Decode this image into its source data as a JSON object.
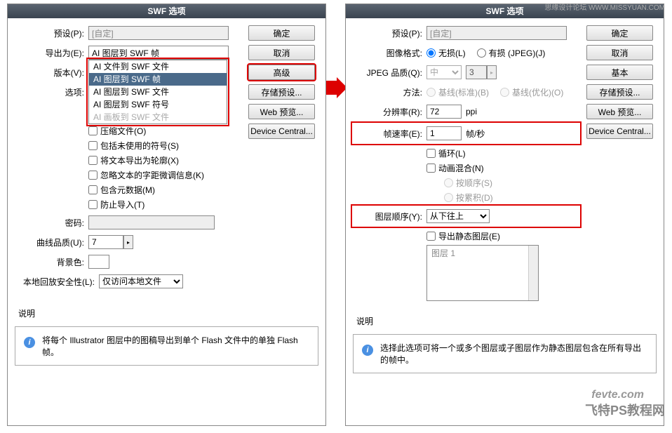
{
  "shared": {
    "title": "SWF 选项",
    "preset_label": "预设(P):",
    "preset_value": "[自定]",
    "desc_header": "说明"
  },
  "buttons": {
    "ok": "确定",
    "cancel": "取消",
    "advanced": "高级",
    "basic": "基本",
    "save_preset": "存储预设...",
    "web_preview": "Web 预览...",
    "device_central": "Device Central..."
  },
  "left": {
    "export_as_label": "导出为(E):",
    "export_selected": "AI 图层到 SWF 帧",
    "version_label": "版本(V):",
    "options_label": "选项:",
    "dropdown_items": [
      "AI 文件到 SWF 文件",
      "AI 图层到 SWF 帧",
      "AI 图层到 SWF 文件",
      "AI 图层到 SWF 符号",
      "AI 画板到 SWF 文件"
    ],
    "compress": "压缩文件(O)",
    "include_unused": "包括未使用的符号(S)",
    "text_as_outline": "将文本导出为轮廓(X)",
    "ignore_kerning": "忽略文本的字距微调信息(K)",
    "include_meta": "包含元数据(M)",
    "prevent_import": "防止导入(T)",
    "password_label": "密码:",
    "curve_quality_label": "曲线品质(U):",
    "curve_quality_value": "7",
    "bgcolor_label": "背景色:",
    "local_security_label": "本地回放安全性(L):",
    "local_security_value": "仅访问本地文件",
    "desc_text": "将每个 Illustrator 图层中的图稿导出到单个 Flash 文件中的单独 Flash 帧。"
  },
  "right": {
    "image_format_label": "图像格式:",
    "lossless": "无损(L)",
    "lossy": "有损 (JPEG)(J)",
    "jpeg_quality_label": "JPEG 品质(Q):",
    "jpeg_quality_value": "中",
    "jpeg_quality_num": "3",
    "method_label": "方法:",
    "baseline_std": "基线(标准)(B)",
    "baseline_opt": "基线(优化)(O)",
    "resolution_label": "分辨率(R):",
    "resolution_value": "72",
    "resolution_unit": "ppi",
    "framerate_label": "帧速率(E):",
    "framerate_value": "1",
    "framerate_unit": "帧/秒",
    "loop": "循环(L)",
    "blend": "动画混合(N)",
    "by_order": "按顺序(S)",
    "by_accum": "按累积(D)",
    "layer_order_label": "图层顺序(Y):",
    "layer_order_value": "从下往上",
    "export_static": "导出静态图层(E)",
    "static_item": "图层 1",
    "desc_text": "选择此选项可将一个或多个图层或子图层作为静态图层包含在所有导出的帧中。"
  },
  "watermarks": {
    "top": "思缘设计论坛  WWW.MISSYUAN.COM",
    "fevte": "fevte.com",
    "fei": "飞特PS教程网"
  }
}
